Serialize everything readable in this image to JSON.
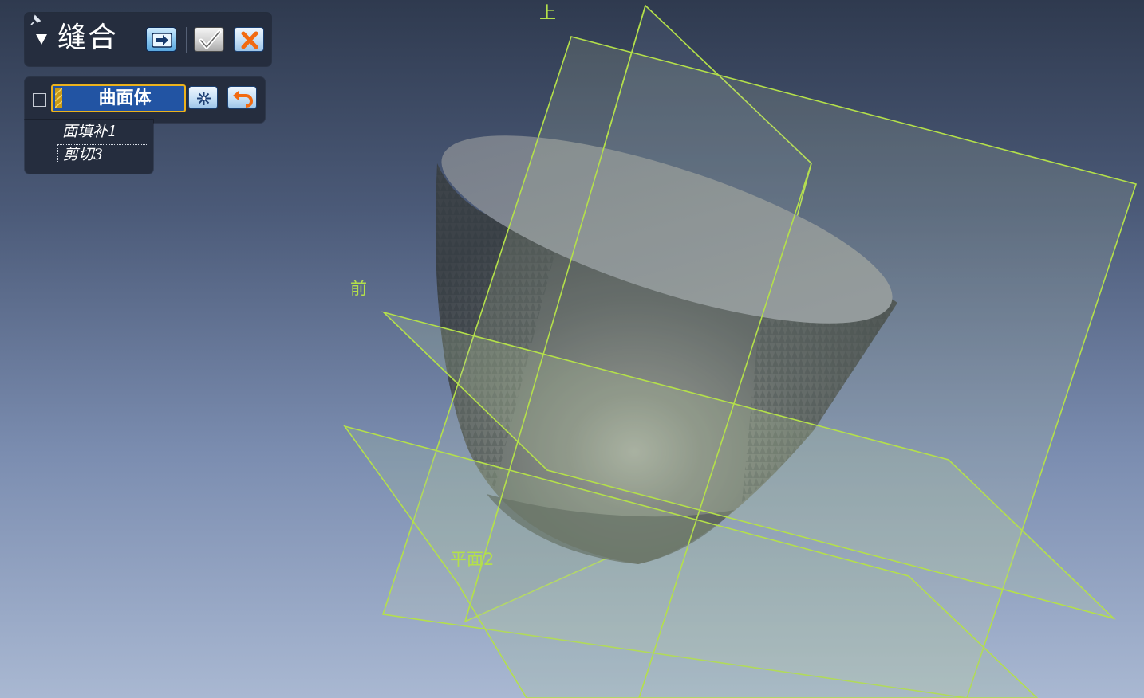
{
  "command": {
    "title": "缝合",
    "buttons": {
      "next": "next-arrow-icon",
      "accept": "checkmark-icon",
      "cancel": "cancel-x-icon"
    }
  },
  "selector": {
    "label": "曲面体",
    "buttons": {
      "options": "sparkle-icon",
      "undo": "undo-arrow-icon"
    }
  },
  "selected_items": [
    "面填补1",
    "剪切3"
  ],
  "plane_labels": {
    "top": "上",
    "front": "前",
    "plane2": "平面2"
  },
  "colors": {
    "plane_outline": "#b4e04a",
    "panel_bg": "#252d3e",
    "selector_bg": "#2254a3",
    "selector_border": "#ecb21c",
    "model": "#5b6168"
  }
}
